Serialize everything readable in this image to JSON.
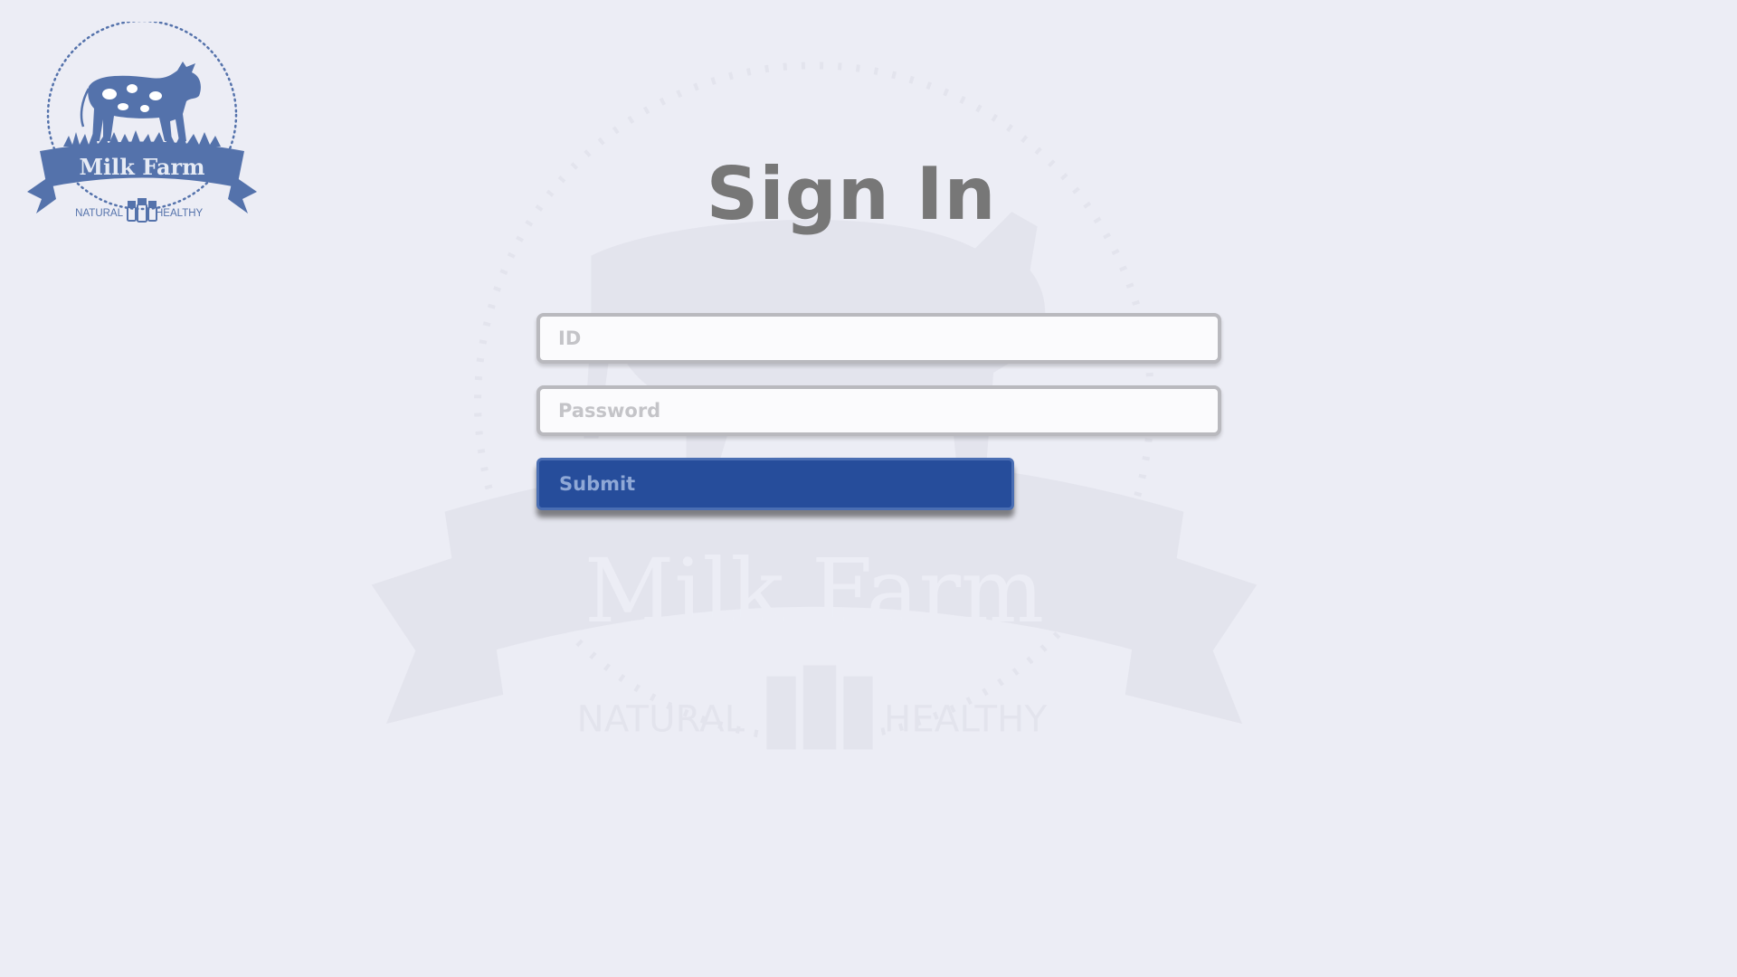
{
  "brand": {
    "name": "Milk Farm",
    "tagline_left": "NATURAL",
    "tagline_right": "HEALTHY",
    "logo_icon": "cow-milk-farm-logo",
    "color": "#5472ab"
  },
  "form": {
    "title": "Sign In",
    "id_placeholder": "ID",
    "id_value": "",
    "password_placeholder": "Password",
    "password_value": "",
    "submit_label": "Submit"
  },
  "colors": {
    "background": "#ecedf5",
    "title": "#777777",
    "submit_bg": "#264d9b",
    "submit_text": "#8fa8d6"
  }
}
